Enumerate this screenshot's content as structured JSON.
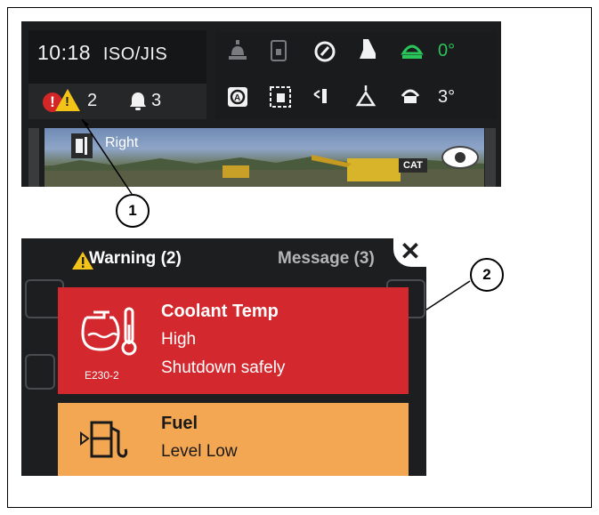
{
  "status": {
    "time": "10:18",
    "mode": "ISO/JIS",
    "warning_count": "2",
    "message_count": "3"
  },
  "indicators": {
    "angle_top": "0°",
    "angle_bottom": "3°",
    "angle_top_color": "#29c45a"
  },
  "camera": {
    "label": "Right",
    "brand": "CAT"
  },
  "callouts": {
    "one": "1",
    "two": "2"
  },
  "alerts_panel": {
    "tab_warning": "Warning (2)",
    "tab_message": "Message (3)",
    "close": "✕",
    "cards": [
      {
        "title": "Coolant Temp",
        "line1": "High",
        "line2": "Shutdown safely",
        "code": "E230-2",
        "color": "#d3282d"
      },
      {
        "title": "Fuel",
        "line1": "Level Low",
        "color": "#f4a752"
      }
    ]
  }
}
